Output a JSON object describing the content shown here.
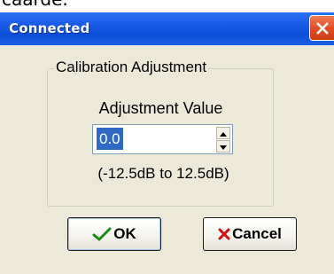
{
  "top_partial_text": "caarde.",
  "dialog": {
    "title": "Connected",
    "close_icon": "close-x-icon",
    "groupbox_label": "Calibration Adjustment",
    "adjustment_label": "Adjustment Value",
    "spin_value": "0.0",
    "range_text": "(-12.5dB to 12.5dB)",
    "ok_label": "OK",
    "cancel_label": "Cancel",
    "ok_icon": "checkmark-icon",
    "cancel_icon": "x-mark-icon"
  },
  "colors": {
    "titlebar": "#0a4fd8",
    "close_button": "#e2502a",
    "dialog_background": "#ece9d8",
    "selection": "#316ac5",
    "ok_check": "#1a8a1a",
    "cancel_x": "#d01010"
  }
}
